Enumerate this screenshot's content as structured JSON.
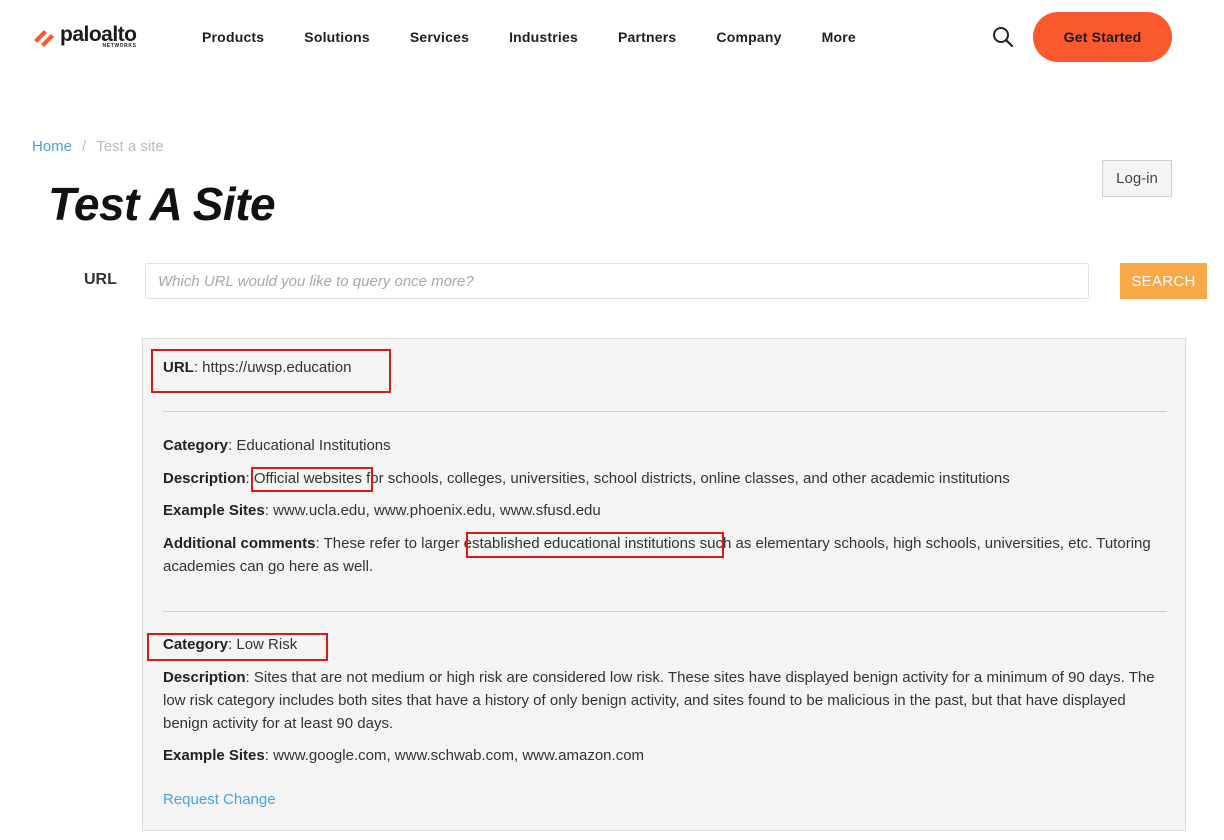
{
  "header": {
    "logo_text": "paloalto",
    "logo_subtext": "NETWORKS",
    "nav": [
      "Products",
      "Solutions",
      "Services",
      "Industries",
      "Partners",
      "Company",
      "More"
    ],
    "search_icon": "search-icon",
    "cta_label": "Get Started",
    "brand_color": "#fa582d"
  },
  "breadcrumb": {
    "home": "Home",
    "separator": "/",
    "current": "Test a site"
  },
  "page_title": "Test A Site",
  "login_label": "Log-in",
  "query": {
    "label": "URL",
    "placeholder": "Which URL would you like to query once more?",
    "value": "",
    "button_label": "SEARCH",
    "button_color": "#f8a847"
  },
  "result": {
    "url_label": "URL",
    "url_value": "https://uwsp.education",
    "category1": {
      "label": "Category",
      "value": "Educational Institutions",
      "description_label": "Description",
      "description_highlight": "Official websites",
      "description_rest": " for schools, colleges, universities, school districts, online classes, and other academic institutions",
      "examples_label": "Example Sites",
      "examples": "www.ucla.edu, www.phoenix.edu, www.sfusd.edu",
      "comments_label": "Additional comments",
      "comments_pre": "These refer to larger ",
      "comments_highlight": "established educational institutions",
      "comments_post": " such as elementary schools, high schools, universities, etc. Tutoring academies can go here as well."
    },
    "category2": {
      "label": "Category",
      "value": "Low Risk",
      "description_label": "Description",
      "description": "Sites that are not medium or high risk are considered low risk. These sites have displayed benign activity for a minimum of 90 days. The low risk category includes both sites that have a history of only benign activity, and sites found to be malicious in the past, but that have displayed benign activity for at least 90 days.",
      "examples_label": "Example Sites",
      "examples": "www.google.com, www.schwab.com, www.amazon.com"
    },
    "request_change": "Request Change"
  },
  "annotation_color": "#e01616"
}
